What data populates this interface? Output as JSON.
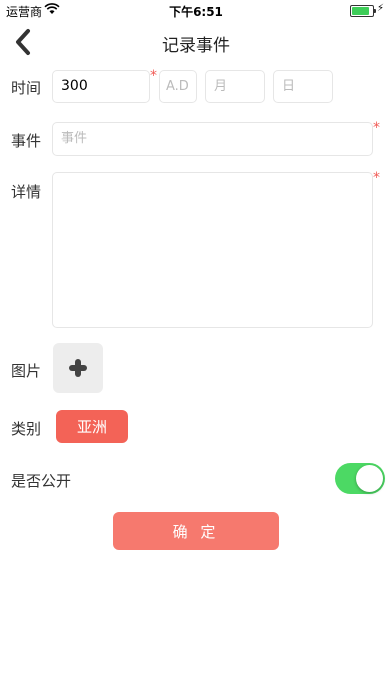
{
  "status_bar": {
    "carrier": "运营商",
    "time": "下午6:51"
  },
  "nav": {
    "title": "记录事件"
  },
  "form": {
    "time": {
      "label": "时间",
      "value": "300",
      "era_placeholder": "A.D",
      "month_placeholder": "月",
      "day_placeholder": "日"
    },
    "event": {
      "label": "事件",
      "placeholder": "事件"
    },
    "details": {
      "label": "详情",
      "value": ""
    },
    "image": {
      "label": "图片"
    },
    "category": {
      "label": "类别",
      "value": "亚洲"
    },
    "public": {
      "label": "是否公开",
      "on": true
    },
    "required_mark": "*"
  },
  "confirm_button": "确 定",
  "colors": {
    "accent": "#f36357",
    "confirm": "#f6796e",
    "toggle_on": "#4cd964",
    "required": "#f15a55"
  }
}
